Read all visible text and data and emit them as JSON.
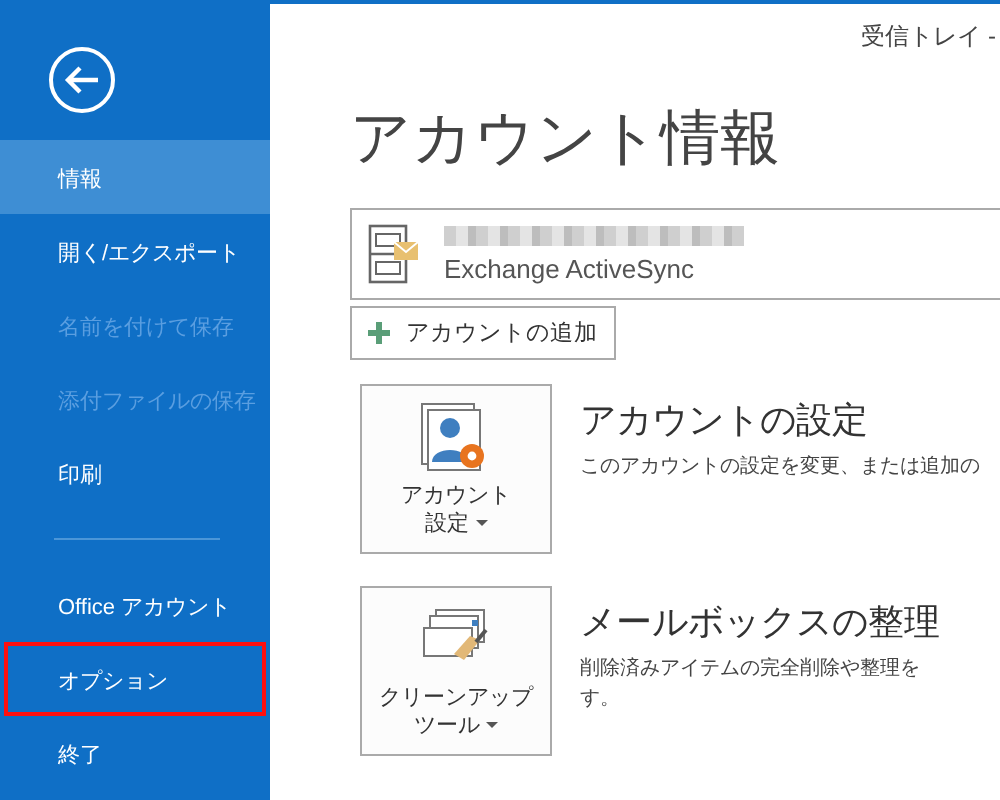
{
  "window": {
    "title": "受信トレイ -"
  },
  "sidebar": {
    "items": [
      {
        "label": "情報",
        "selected": true,
        "disabled": false,
        "highlighted": false,
        "kind": "item"
      },
      {
        "label": "開く/エクスポート",
        "selected": false,
        "disabled": false,
        "highlighted": false,
        "kind": "item"
      },
      {
        "label": "名前を付けて保存",
        "selected": false,
        "disabled": true,
        "highlighted": false,
        "kind": "item"
      },
      {
        "label": "添付ファイルの保存",
        "selected": false,
        "disabled": true,
        "highlighted": false,
        "kind": "item"
      },
      {
        "label": "印刷",
        "selected": false,
        "disabled": false,
        "highlighted": false,
        "kind": "item"
      },
      {
        "kind": "divider"
      },
      {
        "label": "Office アカウント",
        "selected": false,
        "disabled": false,
        "highlighted": false,
        "kind": "item"
      },
      {
        "label": "オプション",
        "selected": false,
        "disabled": false,
        "highlighted": true,
        "kind": "item"
      },
      {
        "label": "終了",
        "selected": false,
        "disabled": false,
        "highlighted": false,
        "kind": "item"
      }
    ]
  },
  "heading": "アカウント情報",
  "account": {
    "type": "Exchange ActiveSync"
  },
  "add_account_button": "アカウントの追加",
  "sections": [
    {
      "kind": "settings",
      "button_lines": [
        "アカウント",
        "設定"
      ],
      "title": "アカウントの設定",
      "description_lines": [
        "このアカウントの設定を変更、または追加の"
      ]
    },
    {
      "kind": "cleanup",
      "button_lines": [
        "クリーンアップ",
        "ツール"
      ],
      "title": "メールボックスの整理",
      "description_lines": [
        "削除済みアイテムの完全削除や整理を",
        "す。"
      ]
    }
  ]
}
